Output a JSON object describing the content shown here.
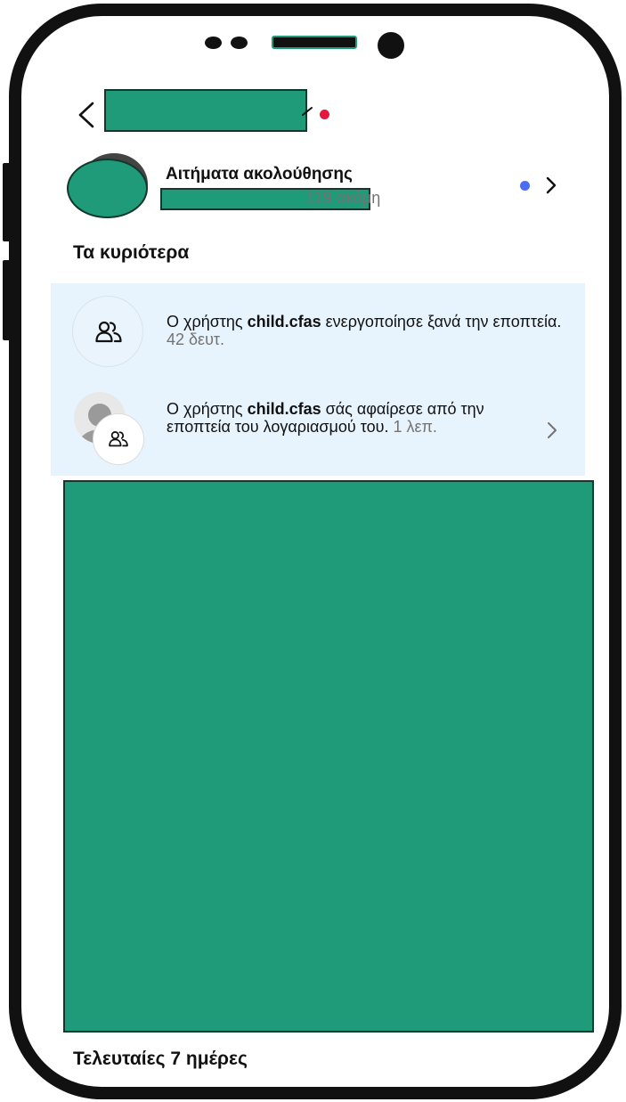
{
  "colors": {
    "redaction_fill": "#1f9b7a",
    "highlight_bg": "#e8f4fd",
    "notification_dot_red": "#e8173f",
    "unread_dot_blue": "#4b6cf5",
    "muted_text": "#737373"
  },
  "header": {
    "back_icon": "chevron-left-icon",
    "title_dropdown_icon": "chevron-down-icon"
  },
  "follow_requests": {
    "title": "Αιτήματα ακολούθησης",
    "more_count": "119 ακόμη",
    "arrow_icon": "chevron-right-icon"
  },
  "sections": {
    "top": "Τα κυριότερα",
    "recent": "Τελευταίες 7 ημέρες"
  },
  "notifications": [
    {
      "prefix": "Ο χρήστης ",
      "username": "child.cfas",
      "message": " ενεργοποίησε ξανά την εποπτεία. ",
      "time": "42 δευτ.",
      "icon": "people-icon"
    },
    {
      "prefix": "Ο χρήστης ",
      "username": "child.cfas",
      "message": " σάς αφαίρεσε από την εποπτεία του λογαριασμού του. ",
      "time": "1 λεπ.",
      "icon": "people-icon",
      "arrow_icon": "chevron-right-icon"
    }
  ]
}
